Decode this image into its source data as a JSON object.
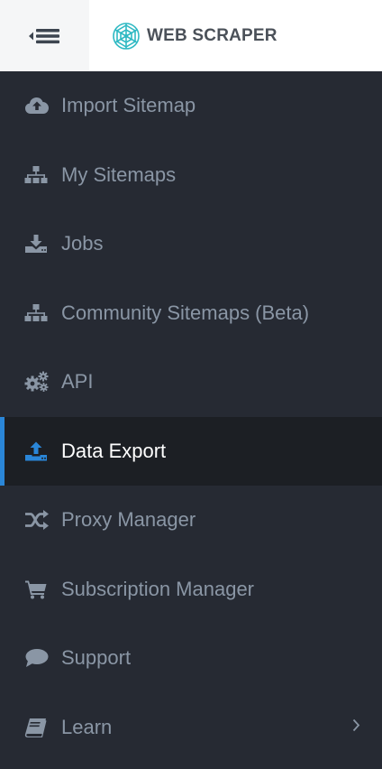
{
  "header": {
    "brand_name": "WEB SCRAPER",
    "toggle_icon": "sidebar-collapse-icon",
    "logo_icon": "spider-web-icon"
  },
  "colors": {
    "sidebar_bg": "#262a33",
    "active_bg": "#1c1f24",
    "accent": "#2a86d8",
    "label": "#8a96a5",
    "active_label": "#ffffff"
  },
  "sidebar": {
    "active_index": 5,
    "items": [
      {
        "label": "Import Sitemap",
        "icon": "cloud-upload-icon"
      },
      {
        "label": "My Sitemaps",
        "icon": "sitemap-icon"
      },
      {
        "label": "Jobs",
        "icon": "download-tray-icon"
      },
      {
        "label": "Community Sitemaps (Beta)",
        "icon": "sitemap-icon"
      },
      {
        "label": "API",
        "icon": "cogs-icon"
      },
      {
        "label": "Data Export",
        "icon": "upload-tray-icon"
      },
      {
        "label": "Proxy Manager",
        "icon": "random-icon"
      },
      {
        "label": "Subscription Manager",
        "icon": "cart-icon"
      },
      {
        "label": "Support",
        "icon": "comment-icon"
      },
      {
        "label": "Learn",
        "icon": "book-icon",
        "has_submenu": true
      }
    ]
  }
}
